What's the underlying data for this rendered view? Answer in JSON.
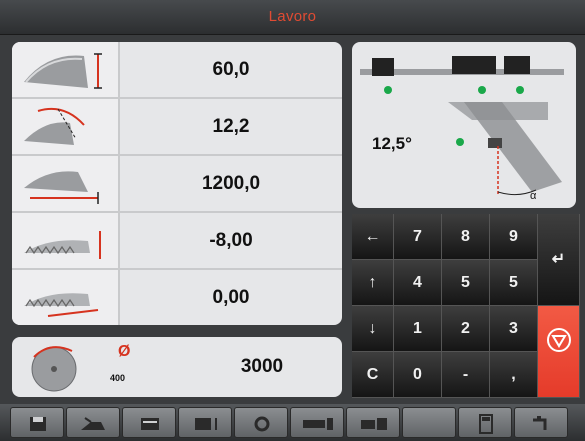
{
  "header": {
    "title": "Lavoro"
  },
  "parameters": [
    {
      "icon": "cut-height-icon",
      "value": "60,0"
    },
    {
      "icon": "miter-angle-icon",
      "value": "12,2"
    },
    {
      "icon": "cut-length-icon",
      "value": "1200,0"
    },
    {
      "icon": "blade-offset-icon",
      "value": "-8,00"
    },
    {
      "icon": "blade-position-icon",
      "value": "0,00"
    }
  ],
  "saw": {
    "icon": "circular-blade-icon",
    "diameter_symbol": "Ø",
    "diameter": "400",
    "value": "3000"
  },
  "diagram": {
    "angle": "12,5°",
    "alpha_label": "α",
    "status_color": "#1aa84a"
  },
  "keypad": {
    "keys": [
      {
        "label": "←",
        "name": "backspace-key"
      },
      {
        "label": "7",
        "name": "key-7"
      },
      {
        "label": "8",
        "name": "key-8"
      },
      {
        "label": "9",
        "name": "key-9"
      },
      {
        "label": "↵",
        "name": "enter-key"
      },
      {
        "label": "↑",
        "name": "up-key"
      },
      {
        "label": "4",
        "name": "key-4"
      },
      {
        "label": "5",
        "name": "key-5"
      },
      {
        "label": "5",
        "name": "key-6"
      },
      {
        "label": "↓",
        "name": "down-key"
      },
      {
        "label": "1",
        "name": "key-1"
      },
      {
        "label": "2",
        "name": "key-2"
      },
      {
        "label": "3",
        "name": "key-3"
      },
      {
        "label": "C",
        "name": "clear-key"
      },
      {
        "label": "0",
        "name": "key-0"
      },
      {
        "label": "-",
        "name": "minus-key"
      },
      {
        "label": ",",
        "name": "comma-key"
      }
    ],
    "stop_color": "#e53b2a"
  },
  "toolbar": {
    "buttons": [
      {
        "name": "save-icon"
      },
      {
        "name": "oil-can-icon"
      },
      {
        "name": "profile-icon"
      },
      {
        "name": "profile-up-icon"
      },
      {
        "name": "blade-ring-icon"
      },
      {
        "name": "bar-feed-icon"
      },
      {
        "name": "clamp-icon"
      },
      {
        "name": "empty-button"
      },
      {
        "name": "calculator-icon"
      },
      {
        "name": "faucet-icon"
      }
    ]
  }
}
